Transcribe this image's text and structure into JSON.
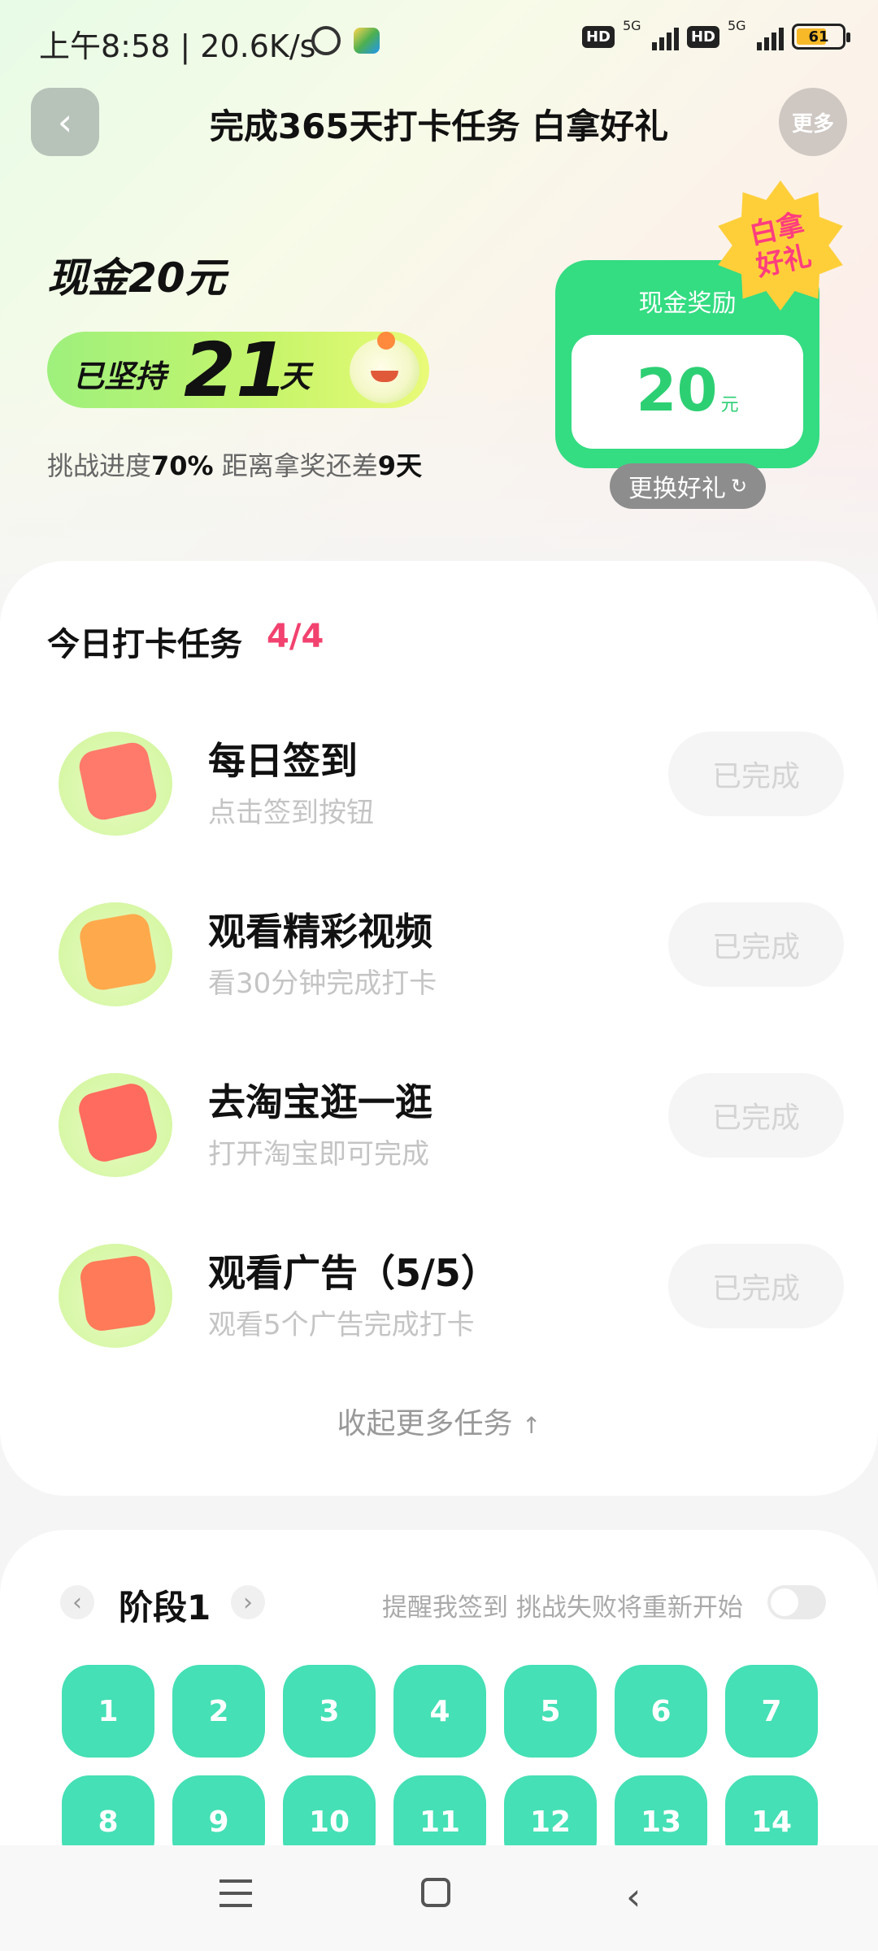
{
  "status_bar": {
    "time": "上午8:58 | 20.6K/s",
    "network_label": "5G",
    "hd_label": "HD",
    "battery": "61"
  },
  "header": {
    "title": "完成365天打卡任务 白拿好礼",
    "more_label": "更多"
  },
  "hero": {
    "cash_title": "现金20元",
    "streak_prefix": "已坚持",
    "streak_days": "21",
    "streak_suffix": "天",
    "progress_text_1": "挑战进度",
    "progress_value": "70%",
    "progress_text_2": " 距离拿奖还差",
    "remaining_days": "9天"
  },
  "reward": {
    "label": "现金奖励",
    "amount": "20",
    "unit": "元",
    "badge": "白拿好礼",
    "swap_label": "更换好礼",
    "swap_icon": "refresh-icon"
  },
  "tasks": {
    "header": "今日打卡任务",
    "count": "4/4",
    "items": [
      {
        "title": "每日签到",
        "subtitle": "点击签到按钮",
        "button": "已完成",
        "icon": "calendar-icon",
        "icon_color": "#ff7a6b"
      },
      {
        "title": "观看精彩视频",
        "subtitle": "看30分钟完成打卡",
        "button": "已完成",
        "icon": "video-icon",
        "icon_color": "#ffa94d"
      },
      {
        "title": "去淘宝逛一逛",
        "subtitle": "打开淘宝即可完成",
        "button": "已完成",
        "icon": "shopping-icon",
        "icon_color": "#ff6b5e"
      },
      {
        "title": "观看广告（5/5）",
        "subtitle": "观看5个广告完成打卡",
        "button": "已完成",
        "icon": "ad-icon",
        "icon_color": "#ff7a59"
      }
    ],
    "collapse_label": "收起更多任务"
  },
  "stage": {
    "title": "阶段1",
    "remind": "提醒我签到 挑战失败将重新开始",
    "reminder_on": false,
    "days": [
      "1",
      "2",
      "3",
      "4",
      "5",
      "6",
      "7",
      "8",
      "9",
      "10",
      "11",
      "12",
      "13",
      "14"
    ]
  },
  "colors": {
    "accent_green": "#34dc82",
    "day_teal": "#45e0b5",
    "count_pink": "#f2426f"
  }
}
